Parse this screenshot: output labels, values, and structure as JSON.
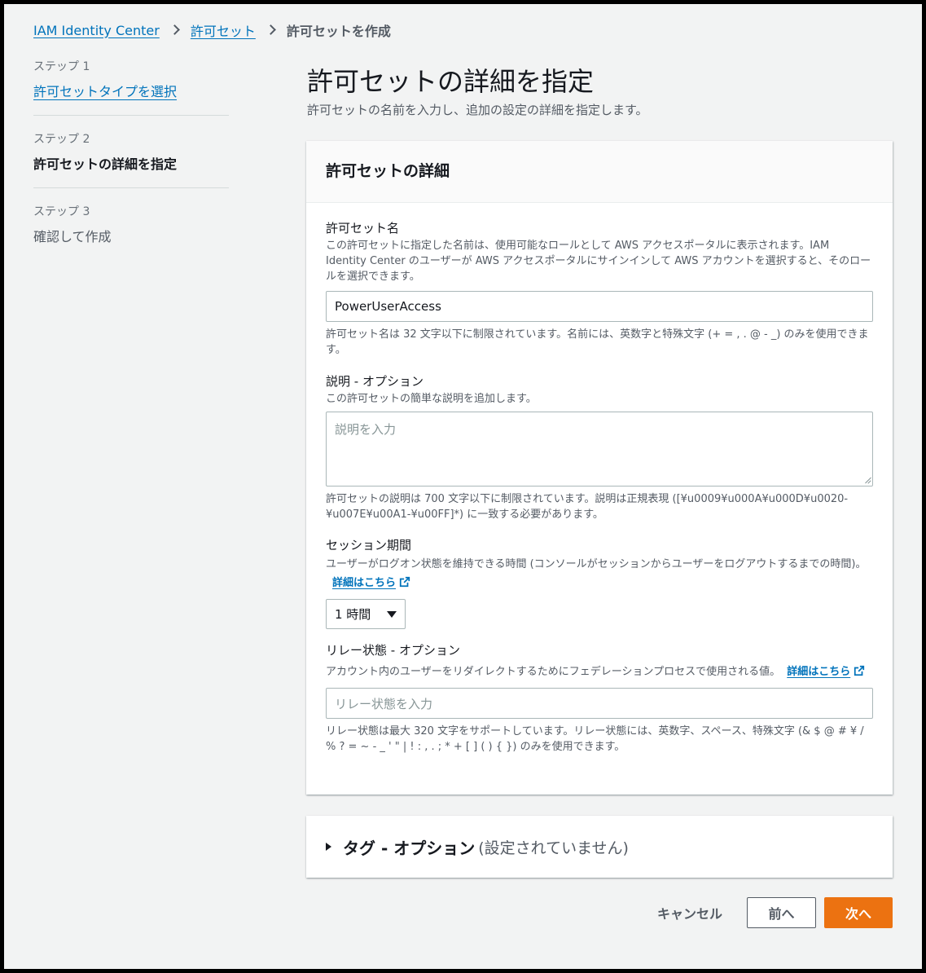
{
  "breadcrumb": {
    "items": [
      "IAM Identity Center",
      "許可セット"
    ],
    "current": "許可セットを作成"
  },
  "steps": [
    {
      "num": "ステップ 1",
      "label": "許可セットタイプを選択"
    },
    {
      "num": "ステップ 2",
      "label": "許可セットの詳細を指定"
    },
    {
      "num": "ステップ 3",
      "label": "確認して作成"
    }
  ],
  "page": {
    "title": "許可セットの詳細を指定",
    "description": "許可セットの名前を入力し、追加の設定の詳細を指定します。"
  },
  "details_panel": {
    "header": "許可セットの詳細",
    "name": {
      "label": "許可セット名",
      "description": "この許可セットに指定した名前は、使用可能なロールとして AWS アクセスポータルに表示されます。IAM Identity Center のユーザーが AWS アクセスポータルにサインインして AWS アカウントを選択すると、そのロールを選択できます。",
      "value": "PowerUserAccess",
      "constraint": "許可セット名は 32 文字以下に制限されています。名前には、英数字と特殊文字 (+ = , . @ - _) のみを使用できます。"
    },
    "description_field": {
      "label": "説明 - オプション",
      "description": "この許可セットの簡単な説明を追加します。",
      "placeholder": "説明を入力",
      "constraint": "許可セットの説明は 700 文字以下に制限されています。説明は正規表現 ([¥u0009¥u000A¥u000D¥u0020-¥u007E¥u00A1-¥u00FF]*) に一致する必要があります。"
    },
    "session": {
      "label": "セッション期間",
      "description": "ユーザーがログオン状態を維持できる時間 (コンソールがセッションからユーザーをログアウトするまでの時間)。",
      "learn_more": "詳細はこちら",
      "selected": "1 時間"
    },
    "relay": {
      "label": "リレー状態 - オプション",
      "description": "アカウント内のユーザーをリダイレクトするためにフェデレーションプロセスで使用される値。",
      "learn_more": "詳細はこちら",
      "placeholder": "リレー状態を入力",
      "constraint": "リレー状態は最大 320 文字をサポートしています。リレー状態には、英数字、スペース、特殊文字 (& $ @ # ¥ / % ? = ~ - _ ' \" | ! : , . ; * + [ ] ( ) { }) のみを使用できます。"
    }
  },
  "tags_panel": {
    "title": "タグ - オプション",
    "status": "(設定されていません)"
  },
  "actions": {
    "cancel": "キャンセル",
    "previous": "前へ",
    "next": "次へ"
  },
  "colors": {
    "link": "#0073bb",
    "primary": "#ec7211",
    "background": "#f2f3f3"
  }
}
